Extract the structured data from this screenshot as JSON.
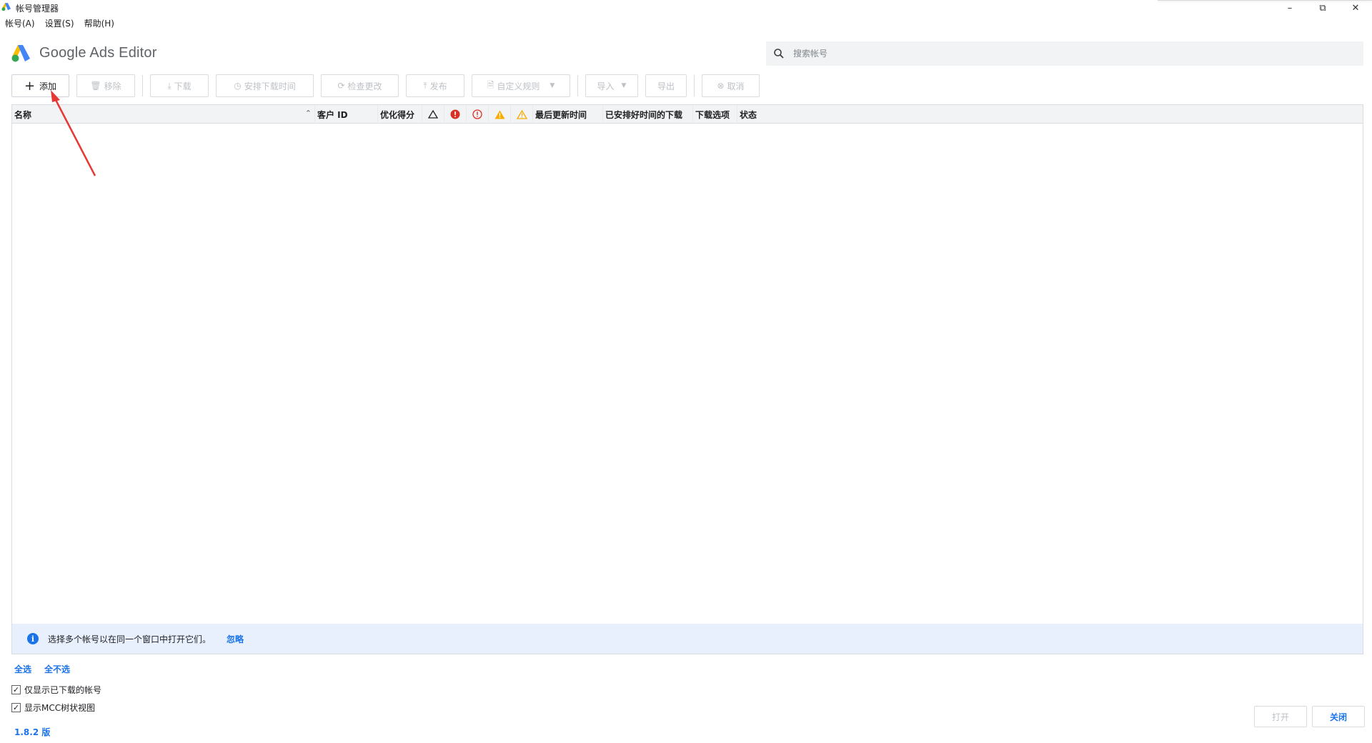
{
  "window": {
    "title": "帐号管理器",
    "controls": [
      "minimize-icon",
      "restore-icon",
      "close-icon"
    ]
  },
  "menu": [
    {
      "label": "帐号(A)"
    },
    {
      "label": "设置(S)"
    },
    {
      "label": "帮助(H)"
    }
  ],
  "brand": {
    "name": "Google Ads Editor"
  },
  "search": {
    "placeholder": "搜索帐号",
    "value": ""
  },
  "toolbar": {
    "add": "添加",
    "remove": "移除",
    "download": "下载",
    "schedule": "安排下载时间",
    "check_changes": "检查更改",
    "publish": "发布",
    "custom_rules": "自定义规则",
    "import": "导入",
    "export": "导出",
    "cancel": "取消"
  },
  "table": {
    "columns": {
      "name": "名称",
      "customer_id": "客户 ID",
      "opt_score": "优化得分",
      "last_updated": "最后更新时间",
      "scheduled_download": "已安排好时间的下载",
      "download_options": "下载选项",
      "status": "状态"
    },
    "icon_columns": [
      "warning-outline-icon",
      "error-filled-icon",
      "error-outline-icon",
      "warning-filled-icon",
      "warning-outline-yellow-icon"
    ],
    "sort_column": "name",
    "rows": []
  },
  "infobar": {
    "text": "选择多个帐号以在同一个窗口中打开它们。",
    "ignore": "忽略"
  },
  "selection": {
    "select_all": "全选",
    "select_none": "全不选"
  },
  "options": {
    "show_downloaded_only": {
      "label": "仅显示已下载的帐号",
      "checked": true
    },
    "show_mcc_tree": {
      "label": "显示MCC树状视图",
      "checked": true
    }
  },
  "version": "1.8.2 版",
  "buttons": {
    "open": "打开",
    "close": "关闭"
  },
  "colors": {
    "accent": "#1a73e8",
    "annotation_arrow": "#e53935",
    "error": "#d93025",
    "warning": "#f9ab00"
  }
}
